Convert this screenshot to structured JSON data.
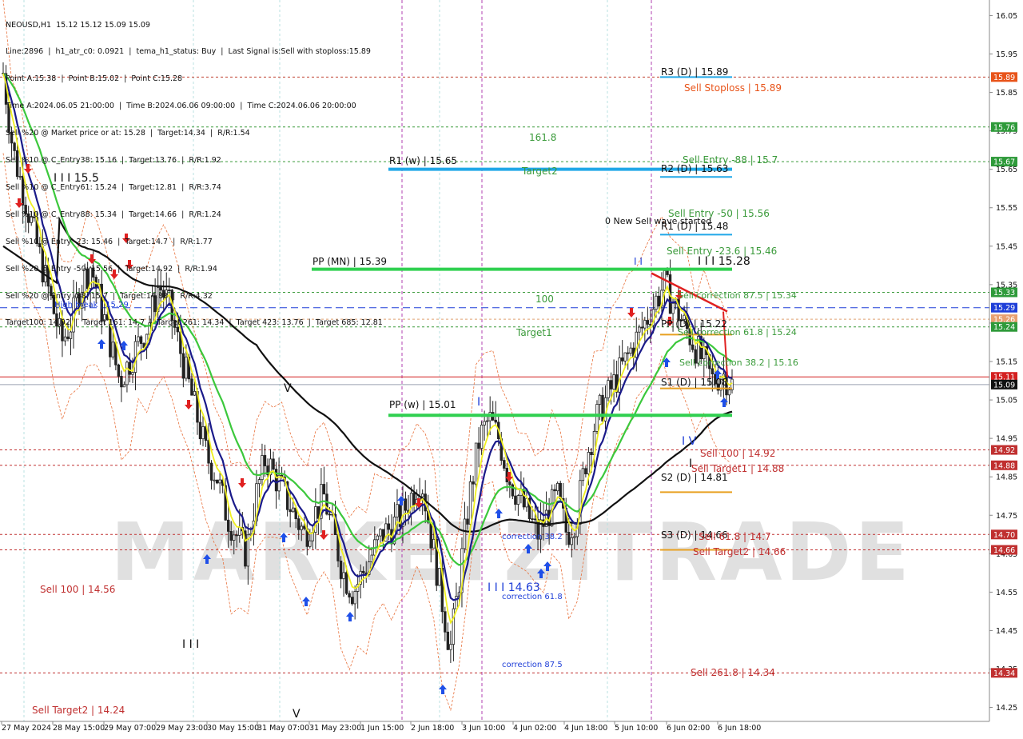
{
  "window": {
    "symbol_line": "NEOUSD,H1  15.12 15.12 15.09 15.09"
  },
  "info_lines": [
    "Line:2896  |  h1_atr_c0: 0.0921  |  tema_h1_status: Buy  |  Last Signal is:Sell with stoploss:15.89",
    "Point A:15.38  |  Point B:15.02  |  Point C:15.28",
    "Time A:2024.06.05 21:00:00  |  Time B:2024.06.06 09:00:00  |  Time C:2024.06.06 20:00:00",
    "Sell %20 @ Market price or at: 15.28  |  Target:14.34  |  R/R:1.54",
    "Sell %10 @ C_Entry38: 15.16  |  Target:13.76  |  R/R:1.92",
    "Sell %10 @ C_Entry61: 15.24  |  Target:12.81  |  R/R:3.74",
    "Sell %10 @ C_Entry88: 15.34  |  Target:14.66  |  R/R:1.24",
    "Sell %10 @ Entry -23: 15.46  |  Target:14.7  |  R/R:1.77",
    "Sell %20 @ Entry -50: 15.56  |  Target:14.92  |  R/R:1.94",
    "Sell %20 @ Entry -88: 15.7  |  Target:14.88  |  R/R:4.32",
    "Target100: 14.92  |  Target 161: 14.7  |  Target 261: 14.34  |  Target 423: 13.76  |  Target 685: 12.81"
  ],
  "watermark": "MARKETZITRADE",
  "price_axis": {
    "ticks": [
      "16.05",
      "15.95",
      "15.85",
      "15.75",
      "15.65",
      "15.55",
      "15.45",
      "15.35",
      "15.25",
      "15.15",
      "15.05",
      "14.95",
      "14.85",
      "14.75",
      "14.65",
      "14.55",
      "14.45",
      "14.35",
      "14.25"
    ],
    "badges": [
      {
        "label": "15.89",
        "color": "#e8541a"
      },
      {
        "label": "15.76",
        "color": "#2e9a3a"
      },
      {
        "label": "15.67",
        "color": "#2e9a3a"
      },
      {
        "label": "15.33",
        "color": "#2e9a3a"
      },
      {
        "label": "15.29",
        "color": "#1f3fd8"
      },
      {
        "label": "15.26",
        "color": "#e8a070"
      },
      {
        "label": "15.24",
        "color": "#2e9a3a"
      },
      {
        "label": "15.11",
        "color": "#d42020"
      },
      {
        "label": "15.09",
        "color": "#111111"
      },
      {
        "label": "14.92",
        "color": "#c03030"
      },
      {
        "label": "14.88",
        "color": "#c03030"
      },
      {
        "label": "14.70",
        "color": "#c03030"
      },
      {
        "label": "14.66",
        "color": "#c03030"
      },
      {
        "label": "14.34",
        "color": "#c03030"
      }
    ]
  },
  "time_axis": [
    "27 May 2024",
    "28 May 15:00",
    "29 May 07:00",
    "29 May 23:00",
    "30 May 15:00",
    "31 May 07:00",
    "31 May 23:00",
    "1 Jun 15:00",
    "2 Jun 18:00",
    "3 Jun 10:00",
    "4 Jun 02:00",
    "4 Jun 18:00",
    "5 Jun 10:00",
    "6 Jun 02:00",
    "6 Jun 18:00"
  ],
  "labels": {
    "r3": "R3 (D) | 15.89",
    "sell_stoploss": "Sell Stoploss | 15.89",
    "fib_161": "161.8",
    "r1w": "R1 (w) | 15.65",
    "target2": "Target2",
    "sell_entry_88": "Sell Entry -88 | 15.7",
    "r2d": "R2 (D) | 15.63",
    "sell_entry_50": "Sell Entry -50 | 15.56",
    "new_wave": "0 New Sell wave started",
    "r1d": "R1 (D) | 15.48",
    "sell_entry_23": "Sell Entry -23.6 | 15.46",
    "wave_1528": "I I I 15.28",
    "pp_mn": "PP (MN) | 15.39",
    "wave_155": "I I I 15.5",
    "corr_875_top": "Sell correction 87.5 | 15.34",
    "fib_100": "100",
    "high_break": "High break | 15.29",
    "target1": "Target1",
    "pp_d": "PP (D) | 15.22",
    "corr_618_top": "Sell correction 61.8 | 15.24",
    "corr_382_top": "Sell correction 38.2 | 15.16",
    "s1d": "S1 (D) | 15.08",
    "pp_w": "PP (w) | 15.01",
    "sell_100": "Sell 100 | 14.92",
    "sell_target1": "Sell Target1 | 14.88",
    "s2d": "S2 (D) | 14.81",
    "s3d": "S3 (D) | 14.66",
    "sell_618": "Sell 61.8 | 14.7",
    "sell_target2_right": "Sell Target2 | 14.66",
    "corr_382_low": "correction 38.2",
    "wave_1463": "I I I 14.63",
    "corr_618_low": "correction 61.8",
    "corr_875_low": "correction 87.5",
    "sell_2618": "Sell 261.8 | 14.34",
    "sell_100_left": "Sell 100 | 14.56",
    "sell_target2_left": "Sell Target2 | 14.24",
    "wave_iv": "I V",
    "wave_v_low": "V",
    "wave_v_mid": "V",
    "wave_iii_low": "I I I",
    "wave_ii": "I I",
    "wave_i_mid": "I",
    "wave_i_right": "I"
  },
  "chart_data": {
    "type": "candlestick",
    "symbol": "NEOUSD",
    "timeframe": "H1",
    "ylim": [
      14.22,
      16.08
    ],
    "last_price": 15.09,
    "levels": [
      {
        "name": "Sell Stoploss",
        "value": 15.89
      },
      {
        "name": "R3 (D)",
        "value": 15.89
      },
      {
        "name": "161.8",
        "value": 15.76
      },
      {
        "name": "Sell Entry -88",
        "value": 15.7
      },
      {
        "name": "R1 (w)",
        "value": 15.65
      },
      {
        "name": "R2 (D)",
        "value": 15.63
      },
      {
        "name": "Sell Entry -50",
        "value": 15.56
      },
      {
        "name": "R1 (D)",
        "value": 15.48
      },
      {
        "name": "Sell Entry -23.6",
        "value": 15.46
      },
      {
        "name": "PP (MN)",
        "value": 15.39
      },
      {
        "name": "Sell correction 87.5",
        "value": 15.34
      },
      {
        "name": "High break",
        "value": 15.29
      },
      {
        "name": "Sell correction 61.8",
        "value": 15.24
      },
      {
        "name": "PP (D)",
        "value": 15.22
      },
      {
        "name": "Sell correction 38.2",
        "value": 15.16
      },
      {
        "name": "S1 (D)",
        "value": 15.08
      },
      {
        "name": "PP (w)",
        "value": 15.01
      },
      {
        "name": "Sell 100",
        "value": 14.92
      },
      {
        "name": "Sell Target1",
        "value": 14.88
      },
      {
        "name": "S2 (D)",
        "value": 14.81
      },
      {
        "name": "Sell 61.8",
        "value": 14.7
      },
      {
        "name": "S3 (D)",
        "value": 14.66
      },
      {
        "name": "Sell Target2",
        "value": 14.66
      },
      {
        "name": "Sell 261.8",
        "value": 14.34
      }
    ],
    "price_path": [
      15.9,
      15.7,
      15.6,
      15.5,
      15.4,
      15.3,
      15.2,
      15.25,
      15.35,
      15.4,
      15.3,
      15.2,
      15.1,
      15.15,
      15.2,
      15.25,
      15.35,
      15.3,
      15.2,
      15.1,
      15.0,
      14.9,
      14.85,
      14.75,
      14.7,
      14.65,
      14.8,
      14.9,
      14.85,
      14.8,
      14.75,
      14.7,
      14.75,
      14.8,
      14.7,
      14.6,
      14.55,
      14.6,
      14.65,
      14.7,
      14.72,
      14.75,
      14.8,
      14.85,
      14.7,
      14.55,
      14.4,
      14.6,
      14.8,
      14.95,
      15.0,
      14.95,
      14.85,
      14.8,
      14.75,
      14.7,
      14.75,
      14.8,
      14.7,
      14.75,
      14.9,
      15.0,
      15.05,
      15.1,
      15.15,
      15.2,
      15.25,
      15.3,
      15.35,
      15.3,
      15.25,
      15.2,
      15.15,
      15.1,
      15.12,
      15.09
    ]
  }
}
